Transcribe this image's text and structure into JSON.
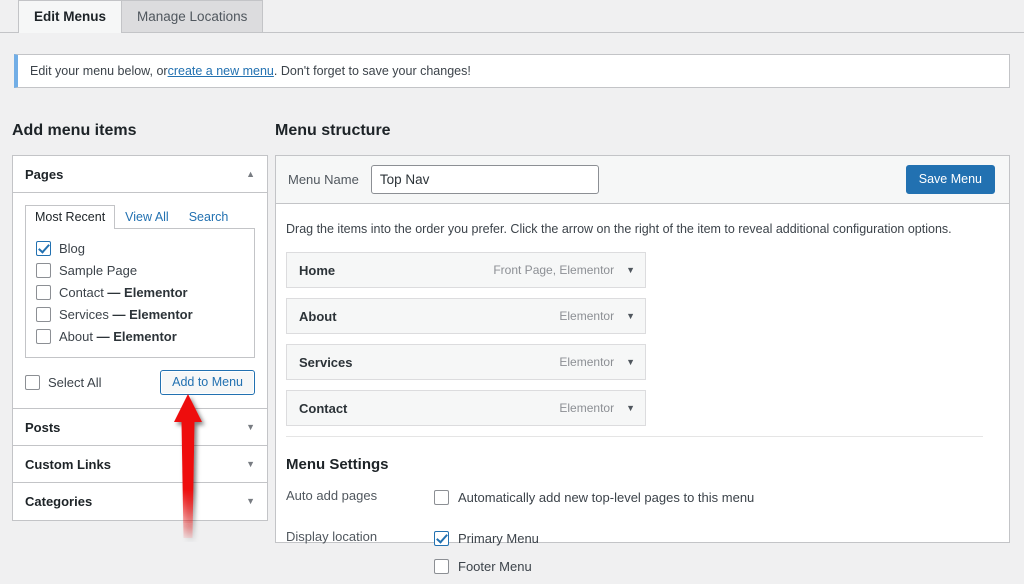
{
  "tabs": [
    {
      "label": "Edit Menus",
      "active": true
    },
    {
      "label": "Manage Locations",
      "active": false
    }
  ],
  "notice": {
    "before": "Edit your menu below, or ",
    "link": "create a new menu",
    "after": ". Don't forget to save your changes!"
  },
  "headings": {
    "add_menu_items": "Add menu items",
    "menu_structure": "Menu structure"
  },
  "sidebar": {
    "pages_panel": {
      "title": "Pages",
      "collapse_icon": "chevron-up-icon",
      "tabs": [
        {
          "label": "Most Recent",
          "active": true
        },
        {
          "label": "View All",
          "active": false
        },
        {
          "label": "Search",
          "active": false
        }
      ],
      "pages": [
        {
          "label": "Blog",
          "suffix": "",
          "checked": true
        },
        {
          "label": "Sample Page",
          "suffix": "",
          "checked": false
        },
        {
          "label": "Contact ",
          "suffix": "— Elementor",
          "checked": false
        },
        {
          "label": "Services ",
          "suffix": "— Elementor",
          "checked": false
        },
        {
          "label": "About ",
          "suffix": "— Elementor",
          "checked": false
        }
      ],
      "select_all_label": "Select All",
      "select_all_checked": false,
      "add_to_menu_label": "Add to Menu"
    },
    "sections": [
      {
        "title": "Posts",
        "icon": "chevron-down-icon"
      },
      {
        "title": "Custom Links",
        "icon": "chevron-down-icon"
      },
      {
        "title": "Categories",
        "icon": "chevron-down-icon"
      }
    ]
  },
  "structure": {
    "menu_name_label": "Menu Name",
    "menu_name_value": "Top Nav",
    "menu_name_placeholder": "Enter menu name here",
    "save_label": "Save Menu",
    "hint": "Drag the items into the order you prefer. Click the arrow on the right of the item to reveal additional configuration options.",
    "items": [
      {
        "title": "Home",
        "type": "Front Page, Elementor",
        "icon": "chevron-down-icon"
      },
      {
        "title": "About",
        "type": "Elementor",
        "icon": "chevron-down-icon"
      },
      {
        "title": "Services",
        "type": "Elementor",
        "icon": "chevron-down-icon"
      },
      {
        "title": "Contact",
        "type": "Elementor",
        "icon": "chevron-down-icon"
      }
    ],
    "settings": {
      "title": "Menu Settings",
      "auto_add_label": "Auto add pages",
      "auto_add_option": "Automatically add new top-level pages to this menu",
      "auto_add_checked": false,
      "display_location_label": "Display location",
      "locations": [
        {
          "label": "Primary Menu",
          "checked": true
        },
        {
          "label": "Footer Menu",
          "checked": false
        }
      ]
    }
  },
  "annotations": {
    "color": "#ee1111",
    "arrows": [
      {
        "name": "arrow-pointing-to-blog-checkbox",
        "direction": "left"
      },
      {
        "name": "arrow-pointing-to-add-to-menu-button",
        "direction": "up"
      }
    ]
  },
  "colors": {
    "accent": "#2271b1",
    "page_background": "#f0f0f1",
    "panel_background": "#ffffff",
    "border": "#c3c4c7"
  }
}
